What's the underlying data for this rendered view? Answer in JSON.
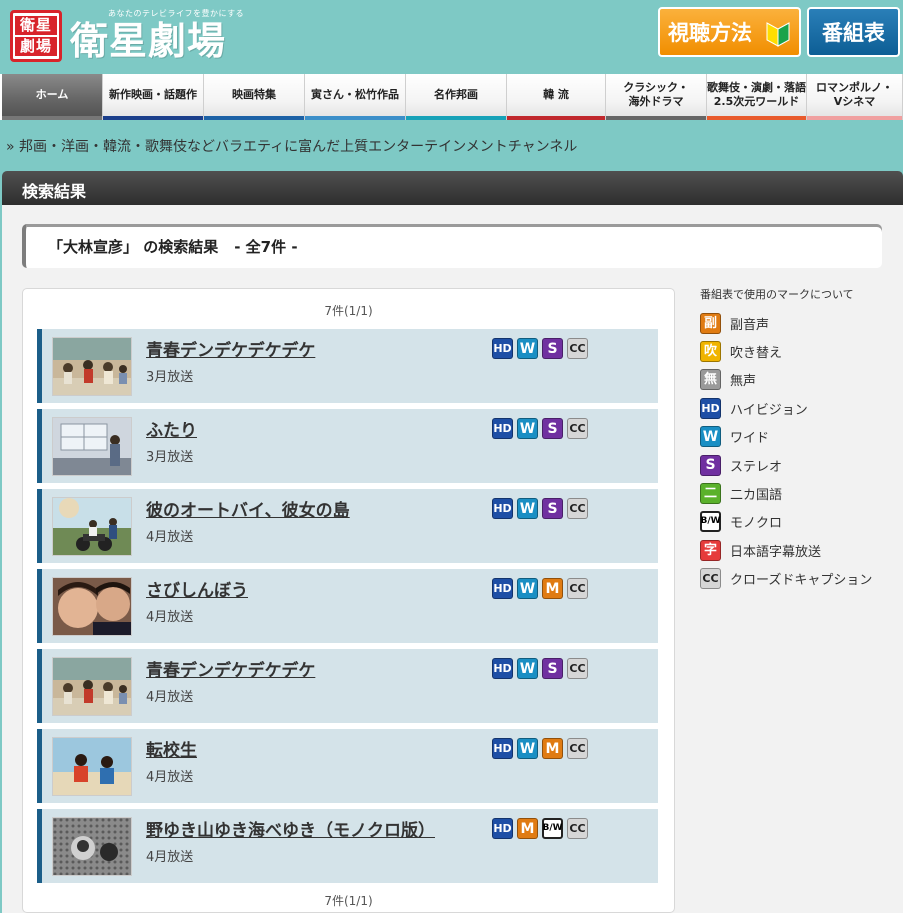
{
  "header": {
    "logo_mark_top": "衛星",
    "logo_mark_bottom": "劇場",
    "tagline": "あなたのテレビライフを豊かにする",
    "logo_text": "衛星劇場",
    "howto_label": "視聴方法",
    "schedule_label": "番組表"
  },
  "nav": {
    "items": [
      {
        "label": "ホーム",
        "accent": "#777777",
        "active": true
      },
      {
        "label": "新作映画・話題作",
        "accent": "#1b3f8b"
      },
      {
        "label": "映画特集",
        "accent": "#1d62a6"
      },
      {
        "label": "寅さん・松竹作品",
        "accent": "#3c8fc9"
      },
      {
        "label": "名作邦画",
        "accent": "#17a2b8"
      },
      {
        "label": "韓 流",
        "accent": "#c0282d"
      },
      {
        "label": "クラシック・\n海外ドラマ",
        "accent": "#666666"
      },
      {
        "label": "歌舞伎・演劇・落語\n2.5次元ワールド",
        "accent": "#e85a2c"
      },
      {
        "label": "ロマンポルノ・\nVシネマ",
        "accent": "#f0a0a0"
      }
    ]
  },
  "site_tagline": "» 邦画・洋画・韓流・歌舞伎などバラエティに富んだ上質エンターテインメントチャンネル",
  "panel_title": "検索結果",
  "search": {
    "query_label": "「大林宣彦」 の検索結果",
    "total_label": "- 全7件 -"
  },
  "pager": {
    "top": "7件(1/1)",
    "bottom": "7件(1/1)"
  },
  "results": [
    {
      "title": "青春デンデケデケデケ",
      "date": "3月放送",
      "marks": [
        "HD",
        "W",
        "S",
        "CC"
      ],
      "thumb": "thumb-beach-group"
    },
    {
      "title": "ふたり",
      "date": "3月放送",
      "marks": [
        "HD",
        "W",
        "S",
        "CC"
      ],
      "thumb": "thumb-window-room"
    },
    {
      "title": "彼のオートバイ、彼女の島",
      "date": "4月放送",
      "marks": [
        "HD",
        "W",
        "S",
        "CC"
      ],
      "thumb": "thumb-motorcycle"
    },
    {
      "title": "さびしんぼう",
      "date": "4月放送",
      "marks": [
        "HD",
        "W",
        "M",
        "CC"
      ],
      "thumb": "thumb-close-up"
    },
    {
      "title": "青春デンデケデケデケ",
      "date": "4月放送",
      "marks": [
        "HD",
        "W",
        "S",
        "CC"
      ],
      "thumb": "thumb-beach-group"
    },
    {
      "title": "転校生",
      "date": "4月放送",
      "marks": [
        "HD",
        "W",
        "M",
        "CC"
      ],
      "thumb": "thumb-seaside-two"
    },
    {
      "title": "野ゆき山ゆき海べゆき（モノクロ版）",
      "date": "4月放送",
      "marks": [
        "HD",
        "M",
        "BW",
        "CC"
      ],
      "thumb": "thumb-monochrome"
    }
  ],
  "legend": {
    "title": "番組表で使用のマークについて",
    "items": [
      {
        "mark": "副",
        "label": "副音声",
        "type": "fuku"
      },
      {
        "mark": "吹",
        "label": "吹き替え",
        "type": "fuki"
      },
      {
        "mark": "無",
        "label": "無声",
        "type": "mu"
      },
      {
        "mark": "HD",
        "label": "ハイビジョン",
        "type": "hd"
      },
      {
        "mark": "W",
        "label": "ワイド",
        "type": "w"
      },
      {
        "mark": "S",
        "label": "ステレオ",
        "type": "s"
      },
      {
        "mark": "二",
        "label": "二カ国語",
        "type": "nika"
      },
      {
        "mark": "BW",
        "label": "モノクロ",
        "type": "bw"
      },
      {
        "mark": "字",
        "label": "日本語字幕放送",
        "type": "ji"
      },
      {
        "mark": "CC",
        "label": "クローズドキャプション",
        "type": "cc"
      }
    ]
  },
  "colors": {
    "background": "#7ec9c5",
    "result_row": "#d4e3e9",
    "result_border": "#1b5e89",
    "howto_orange": "#f18e00",
    "schedule_blue": "#0d5e95"
  }
}
